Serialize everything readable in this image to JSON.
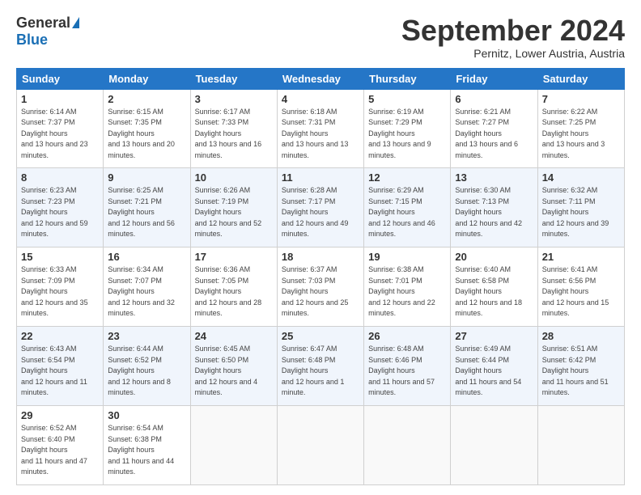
{
  "logo": {
    "general": "General",
    "blue": "Blue"
  },
  "header": {
    "month": "September 2024",
    "location": "Pernitz, Lower Austria, Austria"
  },
  "weekdays": [
    "Sunday",
    "Monday",
    "Tuesday",
    "Wednesday",
    "Thursday",
    "Friday",
    "Saturday"
  ],
  "weeks": [
    [
      {
        "day": "1",
        "sunrise": "6:14 AM",
        "sunset": "7:37 PM",
        "daylight": "13 hours and 23 minutes."
      },
      {
        "day": "2",
        "sunrise": "6:15 AM",
        "sunset": "7:35 PM",
        "daylight": "13 hours and 20 minutes."
      },
      {
        "day": "3",
        "sunrise": "6:17 AM",
        "sunset": "7:33 PM",
        "daylight": "13 hours and 16 minutes."
      },
      {
        "day": "4",
        "sunrise": "6:18 AM",
        "sunset": "7:31 PM",
        "daylight": "13 hours and 13 minutes."
      },
      {
        "day": "5",
        "sunrise": "6:19 AM",
        "sunset": "7:29 PM",
        "daylight": "13 hours and 9 minutes."
      },
      {
        "day": "6",
        "sunrise": "6:21 AM",
        "sunset": "7:27 PM",
        "daylight": "13 hours and 6 minutes."
      },
      {
        "day": "7",
        "sunrise": "6:22 AM",
        "sunset": "7:25 PM",
        "daylight": "13 hours and 3 minutes."
      }
    ],
    [
      {
        "day": "8",
        "sunrise": "6:23 AM",
        "sunset": "7:23 PM",
        "daylight": "12 hours and 59 minutes."
      },
      {
        "day": "9",
        "sunrise": "6:25 AM",
        "sunset": "7:21 PM",
        "daylight": "12 hours and 56 minutes."
      },
      {
        "day": "10",
        "sunrise": "6:26 AM",
        "sunset": "7:19 PM",
        "daylight": "12 hours and 52 minutes."
      },
      {
        "day": "11",
        "sunrise": "6:28 AM",
        "sunset": "7:17 PM",
        "daylight": "12 hours and 49 minutes."
      },
      {
        "day": "12",
        "sunrise": "6:29 AM",
        "sunset": "7:15 PM",
        "daylight": "12 hours and 46 minutes."
      },
      {
        "day": "13",
        "sunrise": "6:30 AM",
        "sunset": "7:13 PM",
        "daylight": "12 hours and 42 minutes."
      },
      {
        "day": "14",
        "sunrise": "6:32 AM",
        "sunset": "7:11 PM",
        "daylight": "12 hours and 39 minutes."
      }
    ],
    [
      {
        "day": "15",
        "sunrise": "6:33 AM",
        "sunset": "7:09 PM",
        "daylight": "12 hours and 35 minutes."
      },
      {
        "day": "16",
        "sunrise": "6:34 AM",
        "sunset": "7:07 PM",
        "daylight": "12 hours and 32 minutes."
      },
      {
        "day": "17",
        "sunrise": "6:36 AM",
        "sunset": "7:05 PM",
        "daylight": "12 hours and 28 minutes."
      },
      {
        "day": "18",
        "sunrise": "6:37 AM",
        "sunset": "7:03 PM",
        "daylight": "12 hours and 25 minutes."
      },
      {
        "day": "19",
        "sunrise": "6:38 AM",
        "sunset": "7:01 PM",
        "daylight": "12 hours and 22 minutes."
      },
      {
        "day": "20",
        "sunrise": "6:40 AM",
        "sunset": "6:58 PM",
        "daylight": "12 hours and 18 minutes."
      },
      {
        "day": "21",
        "sunrise": "6:41 AM",
        "sunset": "6:56 PM",
        "daylight": "12 hours and 15 minutes."
      }
    ],
    [
      {
        "day": "22",
        "sunrise": "6:43 AM",
        "sunset": "6:54 PM",
        "daylight": "12 hours and 11 minutes."
      },
      {
        "day": "23",
        "sunrise": "6:44 AM",
        "sunset": "6:52 PM",
        "daylight": "12 hours and 8 minutes."
      },
      {
        "day": "24",
        "sunrise": "6:45 AM",
        "sunset": "6:50 PM",
        "daylight": "12 hours and 4 minutes."
      },
      {
        "day": "25",
        "sunrise": "6:47 AM",
        "sunset": "6:48 PM",
        "daylight": "12 hours and 1 minute."
      },
      {
        "day": "26",
        "sunrise": "6:48 AM",
        "sunset": "6:46 PM",
        "daylight": "11 hours and 57 minutes."
      },
      {
        "day": "27",
        "sunrise": "6:49 AM",
        "sunset": "6:44 PM",
        "daylight": "11 hours and 54 minutes."
      },
      {
        "day": "28",
        "sunrise": "6:51 AM",
        "sunset": "6:42 PM",
        "daylight": "11 hours and 51 minutes."
      }
    ],
    [
      {
        "day": "29",
        "sunrise": "6:52 AM",
        "sunset": "6:40 PM",
        "daylight": "11 hours and 47 minutes."
      },
      {
        "day": "30",
        "sunrise": "6:54 AM",
        "sunset": "6:38 PM",
        "daylight": "11 hours and 44 minutes."
      },
      null,
      null,
      null,
      null,
      null
    ]
  ]
}
